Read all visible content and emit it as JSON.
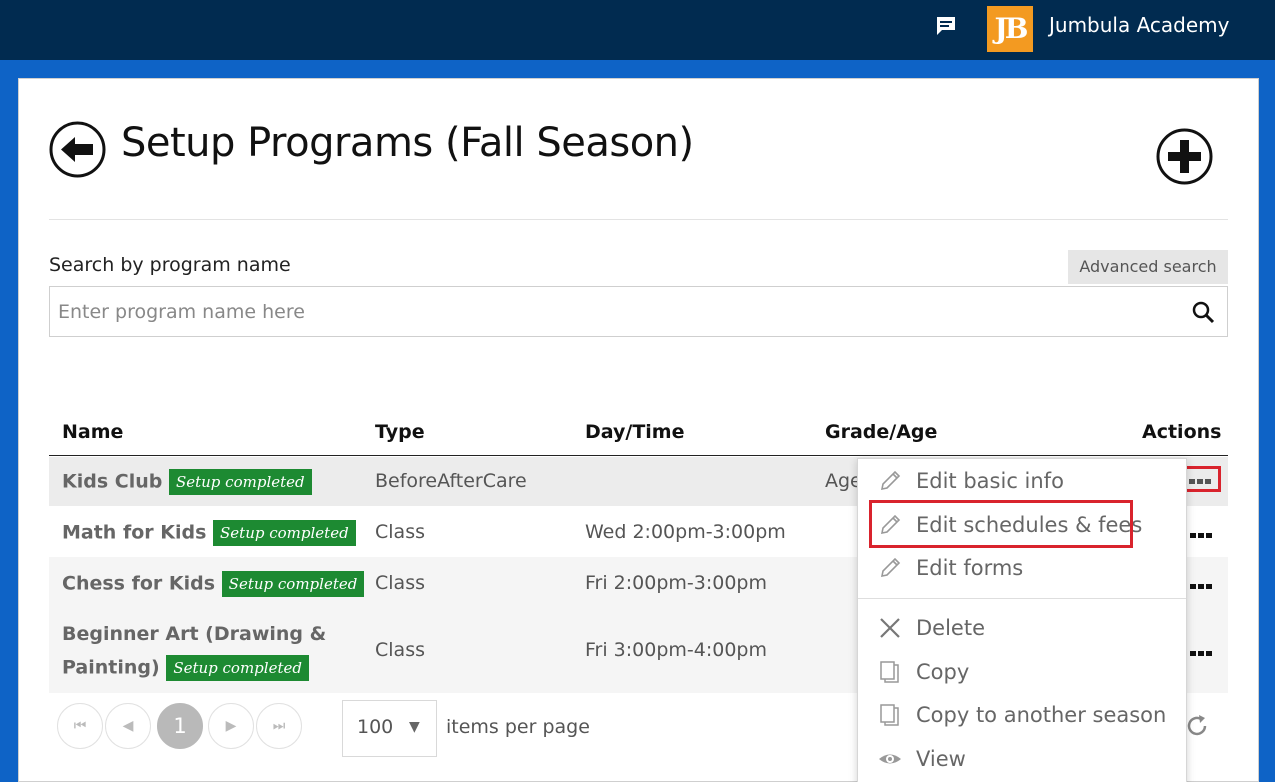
{
  "header": {
    "org_name": "Jumbula Academy",
    "logo_text": "JB",
    "logo_color": "#f39a21",
    "icons": [
      "chat-icon"
    ]
  },
  "page": {
    "title": "Setup Programs (Fall Season)",
    "icons": [
      "back-arrow-icon",
      "add-icon"
    ]
  },
  "search": {
    "label": "Search by program name",
    "placeholder": "Enter program name here",
    "value": "",
    "advanced_label": "Advanced search"
  },
  "table": {
    "columns": [
      "Name",
      "Type",
      "Day/Time",
      "Grade/Age",
      "Actions"
    ],
    "rows": [
      {
        "name": "Kids Club",
        "badge": "Setup completed",
        "type": "BeforeAfterCare",
        "daytime": "",
        "grade": "Age"
      },
      {
        "name": "Math for Kids",
        "badge": "Setup completed",
        "type": "Class",
        "daytime": "Wed 2:00pm-3:00pm",
        "grade": ""
      },
      {
        "name": "Chess for Kids",
        "badge": "Setup completed",
        "type": "Class",
        "daytime": "Fri 2:00pm-3:00pm",
        "grade": ""
      },
      {
        "name_line1": "Beginner Art (Drawing &",
        "name_line2": "Painting)",
        "badge": "Setup completed",
        "type": "Class",
        "daytime": "Fri 3:00pm-4:00pm",
        "grade": ""
      }
    ],
    "badge_color": "#1d8a32"
  },
  "pager": {
    "current_page": "1",
    "per_page": "100",
    "per_page_label": "items per page"
  },
  "actions_menu": {
    "items": [
      {
        "label": "Edit basic info",
        "icon": "pencil-icon"
      },
      {
        "label": "Edit schedules & fees",
        "icon": "pencil-icon"
      },
      {
        "label": "Edit forms",
        "icon": "pencil-icon"
      },
      {
        "label": "Delete",
        "icon": "close-icon"
      },
      {
        "label": "Copy",
        "icon": "copy-icon"
      },
      {
        "label": "Copy to another season",
        "icon": "copy-icon"
      },
      {
        "label": "View",
        "icon": "eye-icon"
      }
    ],
    "highlighted": "Edit schedules & fees",
    "highlight_color": "#d9232d"
  }
}
